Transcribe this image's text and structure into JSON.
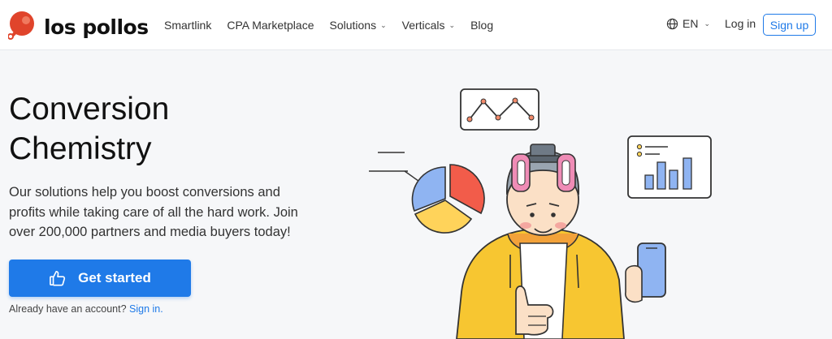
{
  "header": {
    "logo_text": "los pollos",
    "nav": [
      {
        "label": "Smartlink",
        "dropdown": false
      },
      {
        "label": "CPA Marketplace",
        "dropdown": false
      },
      {
        "label": "Solutions",
        "dropdown": true
      },
      {
        "label": "Verticals",
        "dropdown": true
      },
      {
        "label": "Blog",
        "dropdown": false
      }
    ],
    "language": "EN",
    "login_label": "Log in",
    "signup_label": "Sign up"
  },
  "hero": {
    "title_line1": "Conversion",
    "title_line2": "Chemistry",
    "description": "Our solutions help you boost conversions and profits while taking care of all the hard work. Join over 200,000 partners and media buyers today!",
    "cta_label": "Get started",
    "account_prompt": "Already have an account?",
    "signin_label": "Sign in."
  },
  "colors": {
    "accent": "#1f7ae8",
    "logo_red": "#e0442b",
    "hoodie": "#f7c631",
    "chart_red": "#f25c4a",
    "chart_blue": "#8fb4f2",
    "chart_yellow": "#ffd35a"
  },
  "icons": [
    "chicken-logo-icon",
    "globe-icon",
    "chevron-down-icon",
    "thumbs-up-icon"
  ]
}
